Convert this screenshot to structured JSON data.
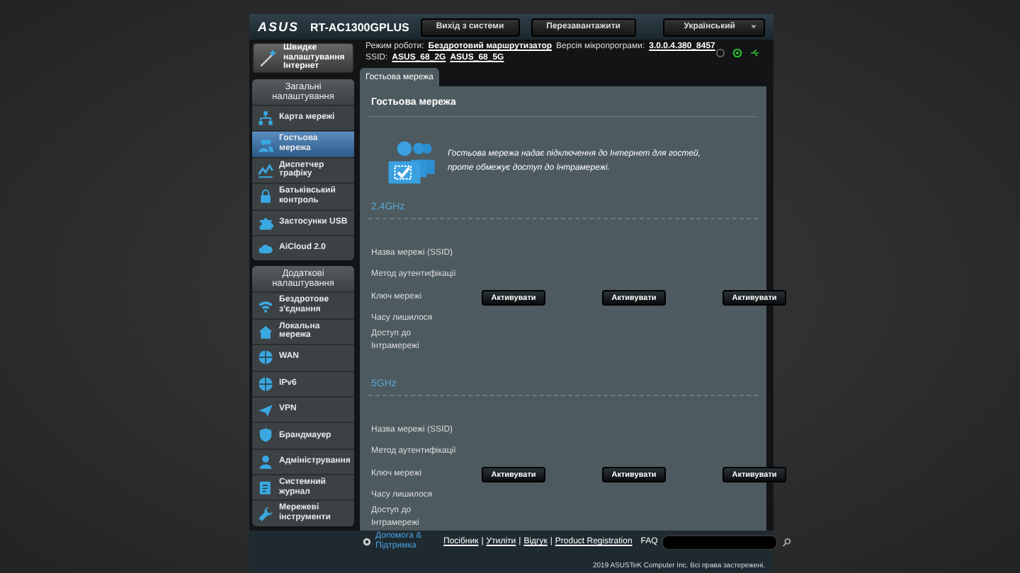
{
  "header": {
    "logo": "ASUS",
    "model": "RT-AC1300GPLUS",
    "buttons": [
      "Вихід з системи",
      "Перезавантажити"
    ],
    "language": "Український"
  },
  "quick_setup": "Швидке налаштування Інтернет",
  "sidebar": [
    {
      "title": "Загальні налаштування",
      "items": [
        {
          "label": "Карта мережі",
          "selected": false
        },
        {
          "label": "Гостьова мережа",
          "selected": true
        },
        {
          "label": "Диспетчер трафіку",
          "selected": false
        },
        {
          "label": "Батьківський контроль",
          "selected": false
        },
        {
          "label": "Застосунки USB",
          "selected": false
        },
        {
          "label": "AiCloud 2.0",
          "selected": false
        }
      ]
    },
    {
      "title": "Додаткові налаштування",
      "items": [
        {
          "label": "Бездротове з'єднання",
          "selected": false
        },
        {
          "label": "Локальна мережа",
          "selected": false
        },
        {
          "label": "WAN",
          "selected": false
        },
        {
          "label": "IPv6",
          "selected": false
        },
        {
          "label": "VPN",
          "selected": false
        },
        {
          "label": "Брандмауер",
          "selected": false
        },
        {
          "label": "Адміністрування",
          "selected": false
        },
        {
          "label": "Системний журнал",
          "selected": false
        },
        {
          "label": "Мережеві інструменти",
          "selected": false
        }
      ]
    }
  ],
  "info": {
    "mode_label": "Режим роботи:",
    "mode": "Бездротовий маршрутизатор",
    "firmware_label": "Версія мікропрограми:",
    "firmware": "3.0.0.4.380_8457",
    "ssid_label": "SSID:",
    "ssids": [
      "ASUS_68_2G",
      "ASUS_68_5G"
    ]
  },
  "tabs": [
    {
      "label": "Гостьова мережа",
      "selected": true
    }
  ],
  "panel": {
    "title": "Гостьова мережа",
    "description": "Гостьова мережа надає підключення до Інтернет для гостей, проте обмежує доступ до Інтрамережі.",
    "bands": [
      {
        "name": "2.4GHz",
        "fields": [
          "Назва мережі (SSID)",
          "Метод аутентифікації",
          "Ключ мережі",
          "Часу лишилося",
          "Доступ до Інтрамережі"
        ],
        "buttons": [
          "Активувати",
          "Активувати",
          "Активувати"
        ]
      },
      {
        "name": "5GHz",
        "fields": [
          "Назва мережі (SSID)",
          "Метод аутентифікації",
          "Ключ мережі",
          "Часу лишилося",
          "Доступ до Інтрамережі"
        ],
        "buttons": [
          "Активувати",
          "Активувати",
          "Активувати"
        ]
      }
    ]
  },
  "footer": {
    "help": "Допомога & Підтримка",
    "links": [
      "Посібник",
      "Утиліти",
      "Відгук",
      "Product Registration"
    ],
    "separator": "|",
    "faq": "FAQ",
    "copyright": "2019 ASUSTeK Computer Inc. Всі права застережені."
  }
}
